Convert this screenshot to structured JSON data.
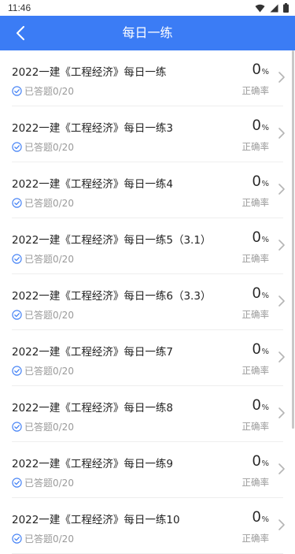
{
  "status": {
    "time": "11:46"
  },
  "header": {
    "title": "每日一练"
  },
  "items": [
    {
      "title": "2022一建《工程经济》每日一练",
      "progress": "已答题0/20",
      "score": "0",
      "unit": "%",
      "score_label": "正确率"
    },
    {
      "title": "2022一建《工程经济》每日一练3",
      "progress": "已答题0/20",
      "score": "0",
      "unit": "%",
      "score_label": "正确率"
    },
    {
      "title": "2022一建《工程经济》每日一练4",
      "progress": "已答题0/20",
      "score": "0",
      "unit": "%",
      "score_label": "正确率"
    },
    {
      "title": "2022一建《工程经济》每日一练5（3.1）",
      "progress": "已答题0/20",
      "score": "0",
      "unit": "%",
      "score_label": "正确率"
    },
    {
      "title": "2022一建《工程经济》每日一练6（3.3）",
      "progress": "已答题0/20",
      "score": "0",
      "unit": "%",
      "score_label": "正确率"
    },
    {
      "title": "2022一建《工程经济》每日一练7",
      "progress": "已答题0/20",
      "score": "0",
      "unit": "%",
      "score_label": "正确率"
    },
    {
      "title": "2022一建《工程经济》每日一练8",
      "progress": "已答题0/20",
      "score": "0",
      "unit": "%",
      "score_label": "正确率"
    },
    {
      "title": "2022一建《工程经济》每日一练9",
      "progress": "已答题0/20",
      "score": "0",
      "unit": "%",
      "score_label": "正确率"
    },
    {
      "title": "2022一建《工程经济》每日一练10",
      "progress": "已答题0/20",
      "score": "0",
      "unit": "%",
      "score_label": "正确率"
    }
  ],
  "colors": {
    "primary": "#3b7cf5",
    "check": "#3b7cf5"
  }
}
